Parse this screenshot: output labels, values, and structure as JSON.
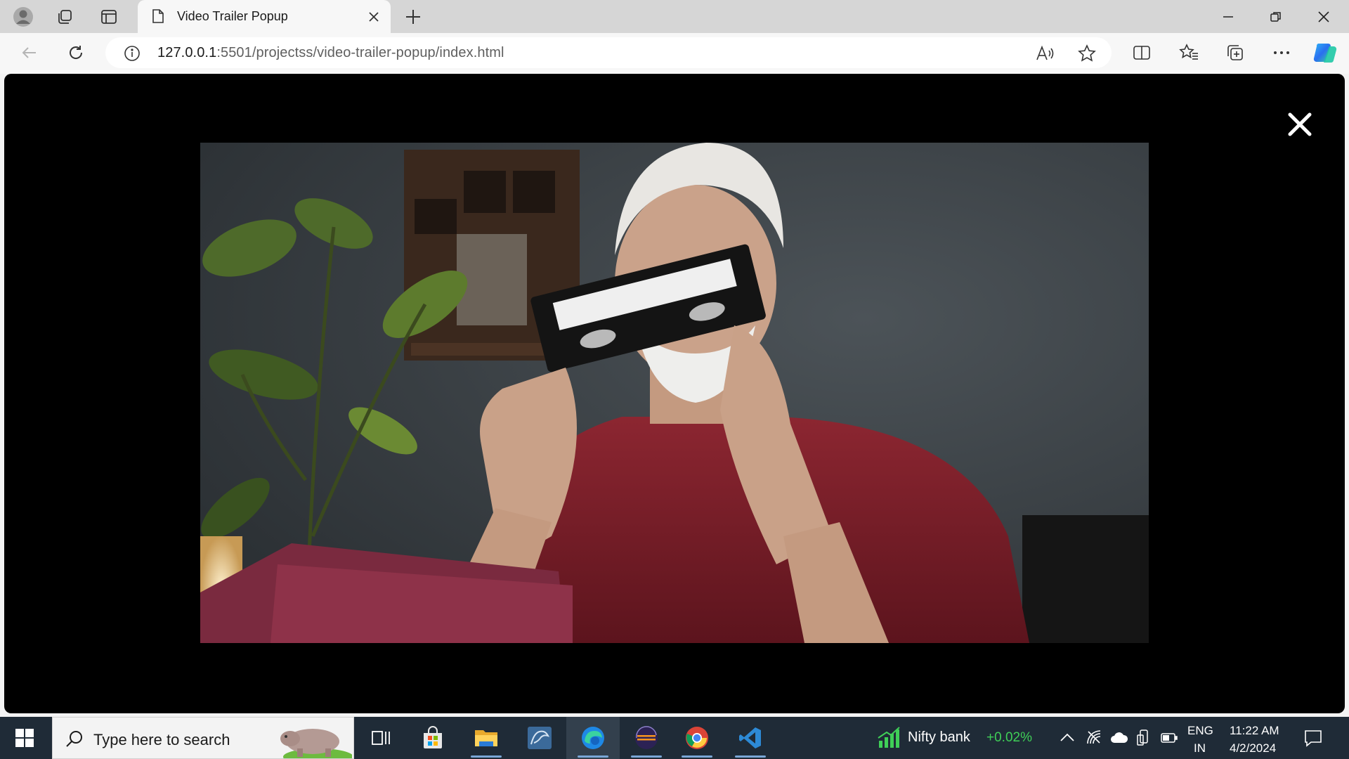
{
  "browser": {
    "tab_title": "Video Trailer Popup",
    "url_host": "127.0.0.1",
    "url_path": ":5501/projectss/video-trailer-popup/index.html"
  },
  "taskbar": {
    "search_placeholder": "Type here to search",
    "stock_name": "Nifty bank",
    "stock_change": "+0.02%",
    "language_line1": "ENG",
    "language_line2": "IN",
    "time": "11:22 AM",
    "date": "4/2/2024"
  },
  "colors": {
    "stock_up": "#3fcf57",
    "taskbar_bg": "#1f2b37",
    "edge_blue": "#1e88e5",
    "vscode_blue": "#2d8ad6"
  }
}
